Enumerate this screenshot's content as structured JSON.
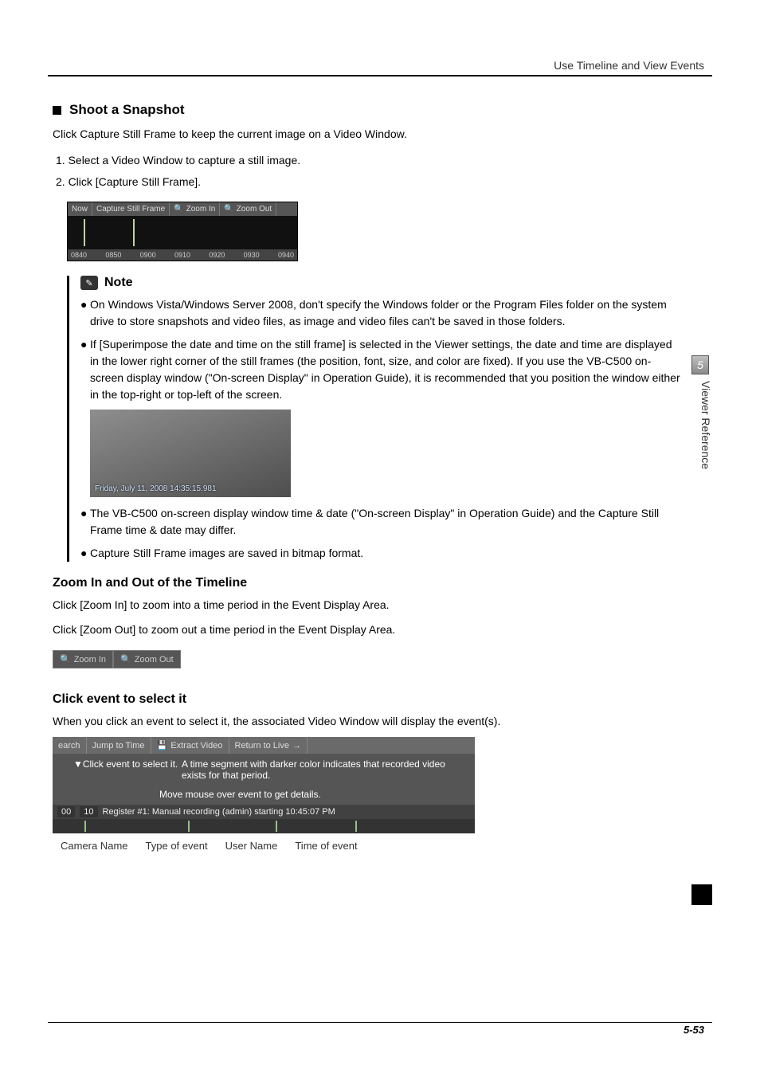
{
  "header": {
    "section": "Use Timeline and View Events"
  },
  "side": {
    "chapter_num": "5",
    "chapter_label": "Viewer Reference"
  },
  "s1": {
    "title": "Shoot a Snapshot",
    "intro": "Click Capture Still Frame to keep the current image on a Video Window.",
    "steps": [
      "1.   Select a Video Window to capture a still image.",
      "2.   Click [Capture Still Frame]."
    ]
  },
  "toolbar1": {
    "now": "Now",
    "capture": "Capture Still Frame",
    "zoom_in": "Zoom In",
    "zoom_out": "Zoom Out",
    "times": [
      "0840",
      "0850",
      "0900",
      "0910",
      "0920",
      "0930",
      "0940"
    ]
  },
  "note": {
    "title": "Note",
    "items": [
      "On Windows Vista/Windows Server 2008, don't specify the Windows folder or the Program Files folder on the system drive to store snapshots and video files, as image and video files can't be saved in those folders.",
      "If [Superimpose the date and time on the still frame] is selected in the Viewer settings, the date and time are displayed in the lower right corner of the still frames (the position, font, size, and color are fixed). If you use the VB-C500 on-screen display window (\"On-screen Display\" in Operation Guide), it is recommended that you position the window either in the top-right or top-left of the screen.",
      "The VB-C500 on-screen display window time & date (\"On-screen Display\" in Operation Guide) and the Capture Still Frame time & date may differ.",
      "Capture Still Frame images are saved in bitmap format."
    ],
    "img_stamp": "Friday, July 11, 2008 14:35:15.981"
  },
  "s2": {
    "title": "Zoom In and Out of the Timeline",
    "p1_a": "Click [",
    "p1_b": "Zoom In",
    "p1_c": "] to zoom into a time period in the Event Display Area.",
    "p2_a": "Click [",
    "p2_b": "Zoom Out",
    "p2_c": "] to zoom out a time period in the Event Display Area.",
    "btn_in": "Zoom In",
    "btn_out": "Zoom Out"
  },
  "s3": {
    "title": "Click event to select it",
    "intro": "When you click an event to select it, the associated Video Window will display the event(s).",
    "bar": {
      "search": "earch",
      "jump": "Jump to Time",
      "extract": "Extract Video",
      "return": "Return to Live"
    },
    "callout1": "Click event to select it.",
    "hint_line1": "A time segment with darker color indicates that recorded video exists for that period.",
    "hint_line2": "Move mouse over event to get details.",
    "strip_left": "00",
    "strip_left2": "10",
    "event_text": "Register #1: Manual recording (admin) starting  10:45:07 PM",
    "labels": [
      "Camera Name",
      "Type of event",
      "User Name",
      "Time of event"
    ]
  },
  "pagenum": "5-53"
}
